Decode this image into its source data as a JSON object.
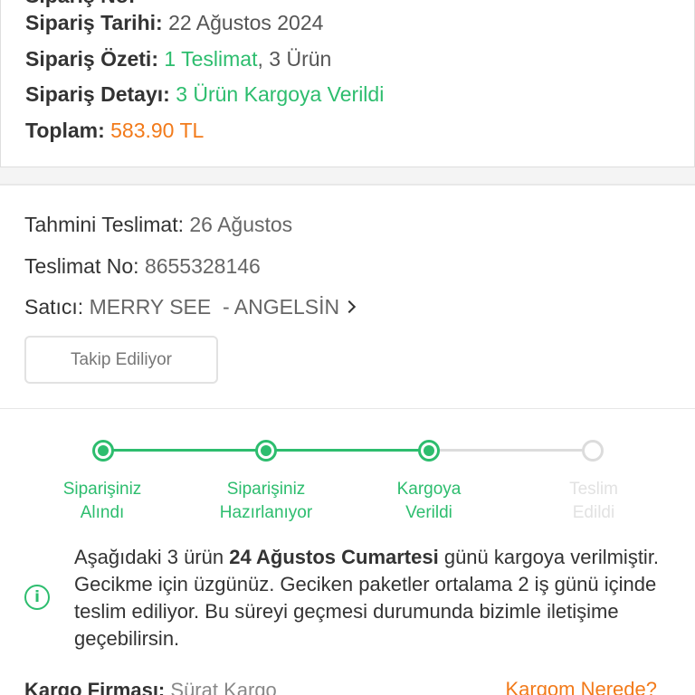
{
  "order": {
    "clipped_top_label": "Sipariş No:",
    "date_label": "Sipariş Tarihi:",
    "date_value": "22 Ağustos 2024",
    "summary_label": "Sipariş Özeti:",
    "summary_deliveries": "1 Teslimat",
    "summary_items": ", 3 Ürün",
    "detail_label": "Sipariş Detayı:",
    "detail_value": "3 Ürün Kargoya Verildi",
    "total_label": "Toplam:",
    "total_value": "583.90 TL"
  },
  "shipment": {
    "estimated_label": "Tahmini Teslimat:",
    "estimated_value": "26 Ağustos",
    "delivery_no_label": "Teslimat No:",
    "delivery_no_value": "8655328146",
    "seller_label": "Satıcı:",
    "seller_value": "MERRY SEE  - ANGELSİN",
    "track_button": "Takip Ediliyor"
  },
  "progress": {
    "steps": [
      {
        "line1": "Siparişiniz",
        "line2": "Alındı",
        "active": true
      },
      {
        "line1": "Siparişiniz",
        "line2": "Hazırlanıyor",
        "active": true
      },
      {
        "line1": "Kargoya",
        "line2": "Verildi",
        "active": true
      },
      {
        "line1": "Teslim",
        "line2": "Edildi",
        "active": false
      }
    ]
  },
  "notice": {
    "icon": "info-icon",
    "text_before": "Aşağıdaki 3 ürün ",
    "text_bold": "24 Ağustos Cumartesi",
    "text_after": " günü kargoya verilmiştir. Gecikme için üzgünüz. Geciken paketler ortalama 2 iş günü içinde teslim ediliyor. Bu süreyi geçmesi durumunda bizimle iletişime geçebilirsin."
  },
  "carrier": {
    "label": "Kargo Firması:",
    "value": "Sürat Kargo",
    "where_link": "Kargom Nerede?"
  },
  "colors": {
    "green": "#2dbd6e",
    "orange": "#f27a1a",
    "inactive": "#dcdcdc"
  }
}
